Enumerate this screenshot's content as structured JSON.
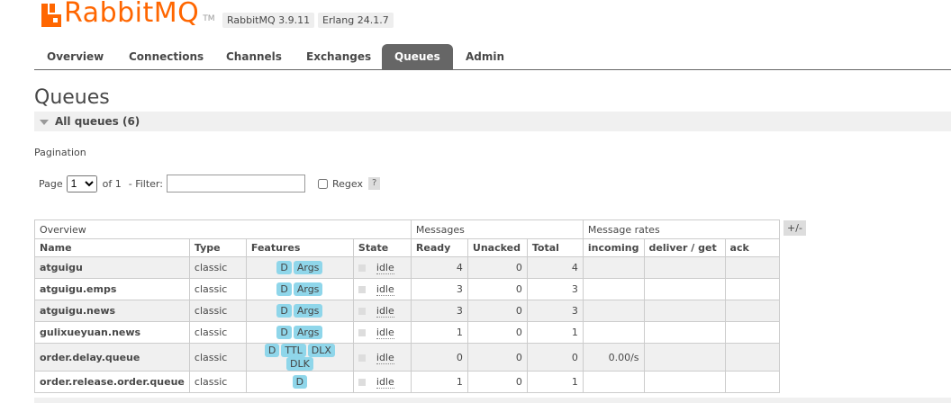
{
  "header": {
    "logo_text": "RabbitMQ",
    "logo_tm": "TM",
    "version": "RabbitMQ 3.9.11",
    "erlang": "Erlang 24.1.7"
  },
  "tabs": [
    {
      "label": "Overview"
    },
    {
      "label": "Connections"
    },
    {
      "label": "Channels"
    },
    {
      "label": "Exchanges"
    },
    {
      "label": "Queues",
      "active": true
    },
    {
      "label": "Admin"
    }
  ],
  "page_title": "Queues",
  "section_title": "All queues (6)",
  "pagination": {
    "label": "Pagination",
    "page_label": "Page",
    "page_value": "1",
    "of_label": "of 1",
    "filter_label": "- Filter:",
    "filter_value": "",
    "regex_label": "Regex",
    "help": "?"
  },
  "table": {
    "group_headers": {
      "overview": "Overview",
      "messages": "Messages",
      "rates": "Message rates"
    },
    "columns": [
      "Name",
      "Type",
      "Features",
      "State",
      "Ready",
      "Unacked",
      "Total",
      "incoming",
      "deliver / get",
      "ack"
    ],
    "plus_minus": "+/-",
    "rows": [
      {
        "name": "atguigu",
        "type": "classic",
        "features": [
          "D",
          "Args"
        ],
        "state": "idle",
        "ready": "4",
        "unacked": "0",
        "total": "4",
        "incoming": "",
        "deliver": "",
        "ack": ""
      },
      {
        "name": "atguigu.emps",
        "type": "classic",
        "features": [
          "D",
          "Args"
        ],
        "state": "idle",
        "ready": "3",
        "unacked": "0",
        "total": "3",
        "incoming": "",
        "deliver": "",
        "ack": ""
      },
      {
        "name": "atguigu.news",
        "type": "classic",
        "features": [
          "D",
          "Args"
        ],
        "state": "idle",
        "ready": "3",
        "unacked": "0",
        "total": "3",
        "incoming": "",
        "deliver": "",
        "ack": ""
      },
      {
        "name": "gulixueyuan.news",
        "type": "classic",
        "features": [
          "D",
          "Args"
        ],
        "state": "idle",
        "ready": "1",
        "unacked": "0",
        "total": "1",
        "incoming": "",
        "deliver": "",
        "ack": ""
      },
      {
        "name": "order.delay.queue",
        "type": "classic",
        "features": [
          "D",
          "TTL",
          "DLX",
          "DLK"
        ],
        "state": "idle",
        "ready": "0",
        "unacked": "0",
        "total": "0",
        "incoming": "0.00/s",
        "deliver": "",
        "ack": ""
      },
      {
        "name": "order.release.order.queue",
        "type": "classic",
        "features": [
          "D"
        ],
        "state": "idle",
        "ready": "1",
        "unacked": "0",
        "total": "1",
        "incoming": "",
        "deliver": "",
        "ack": ""
      }
    ]
  },
  "colors": {
    "accent": "#ff6600",
    "tab_active": "#666666",
    "feature_pill": "#8fd6ea"
  }
}
